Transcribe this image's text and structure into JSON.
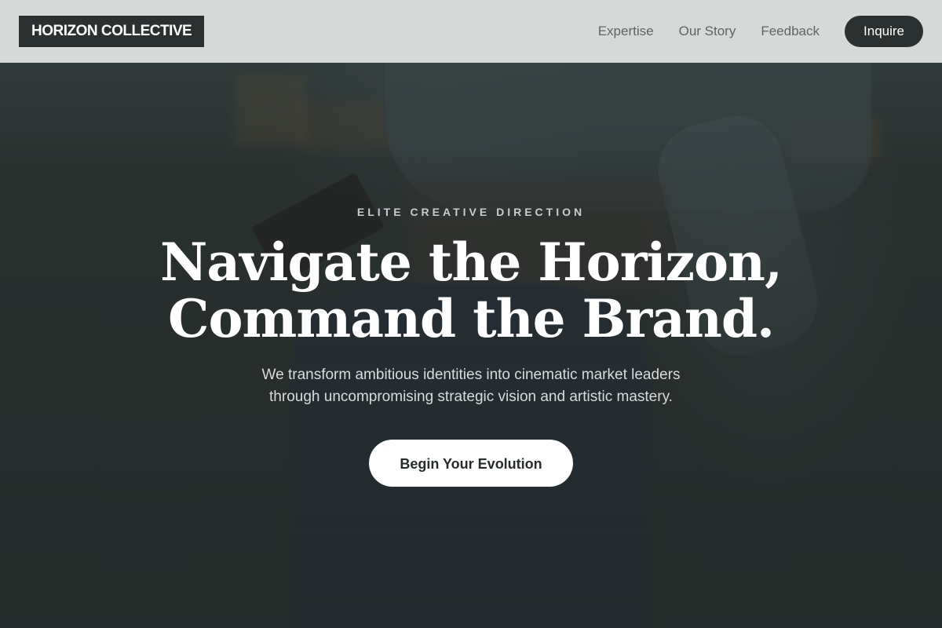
{
  "brand": {
    "logo_text": "HORIZON COLLECTIVE"
  },
  "nav": {
    "links": [
      {
        "label": "Expertise"
      },
      {
        "label": "Our Story"
      },
      {
        "label": "Feedback"
      }
    ],
    "cta_label": "Inquire"
  },
  "hero": {
    "eyebrow": "ELITE CREATIVE DIRECTION",
    "headline_line1": "Navigate the Horizon,",
    "headline_line2": "Command the Brand.",
    "subtext_line1": "We transform ambitious identities into cinematic market leaders",
    "subtext_line2": "through uncompromising strategic vision and artistic mastery.",
    "cta_label": "Begin Your Evolution"
  },
  "colors": {
    "dark": "#2b3130",
    "nav_bg": "#dee0e0",
    "white": "#ffffff"
  }
}
